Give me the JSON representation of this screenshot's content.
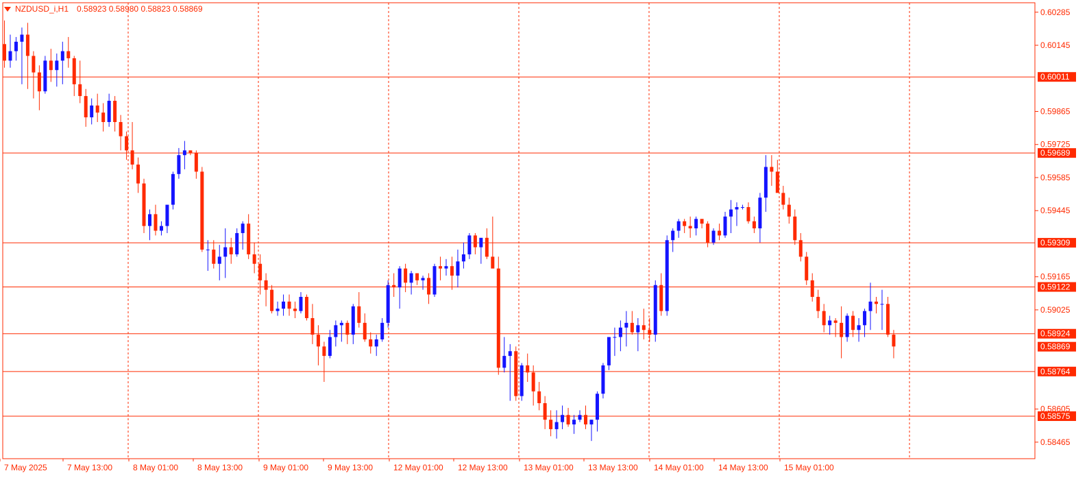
{
  "header": {
    "symbol": "NZDUSD_i,H1",
    "ohlc": "0.58923 0.58980 0.58823 0.58869"
  },
  "colors": {
    "bull": "#1414ff",
    "bear": "#ff2a00",
    "grid": "#ff2a00",
    "background": "#ffffff"
  },
  "chart_data": {
    "type": "candlestick",
    "timeframe": "H1",
    "ylim": [
      0.58395,
      0.60325
    ],
    "y_ticks": [
      "0.60285",
      "0.60145",
      "0.59865",
      "0.59725",
      "0.59585",
      "0.59445",
      "0.59165",
      "0.59025",
      "0.58605",
      "0.58465"
    ],
    "x_ticks": [
      "7 May 2025",
      "7 May 13:00",
      "8 May 01:00",
      "8 May 13:00",
      "9 May 01:00",
      "9 May 13:00",
      "12 May 01:00",
      "12 May 13:00",
      "13 May 01:00",
      "13 May 13:00",
      "14 May 01:00",
      "14 May 13:00",
      "15 May 01:00"
    ],
    "horizontal_levels": [
      "0.60011",
      "0.59689",
      "0.59309",
      "0.59122",
      "0.58924",
      "0.58764",
      "0.58575"
    ],
    "current_price": "0.58869",
    "candles": [
      [
        0.6015,
        0.6025,
        0.6005,
        0.6008
      ],
      [
        0.6008,
        0.6019,
        0.6005,
        0.6012
      ],
      [
        0.6012,
        0.6018,
        0.6008,
        0.6016
      ],
      [
        0.6016,
        0.6022,
        0.5998,
        0.6019
      ],
      [
        0.6019,
        0.6024,
        0.5996,
        0.601
      ],
      [
        0.601,
        0.6012,
        0.5992,
        0.6003
      ],
      [
        0.6003,
        0.6006,
        0.5987,
        0.5995
      ],
      [
        0.5995,
        0.601,
        0.5994,
        0.6008
      ],
      [
        0.6008,
        0.6013,
        0.5999,
        0.6004
      ],
      [
        0.6004,
        0.6011,
        0.5997,
        0.6008
      ],
      [
        0.6008,
        0.6016,
        0.5998,
        0.6012
      ],
      [
        0.6012,
        0.6018,
        0.6005,
        0.6009
      ],
      [
        0.6009,
        0.601,
        0.5993,
        0.5998
      ],
      [
        0.5998,
        0.6008,
        0.599,
        0.5993
      ],
      [
        0.5993,
        0.5996,
        0.598,
        0.5984
      ],
      [
        0.5984,
        0.5992,
        0.5981,
        0.5989
      ],
      [
        0.5989,
        0.5994,
        0.5982,
        0.5986
      ],
      [
        0.5986,
        0.599,
        0.5978,
        0.5982
      ],
      [
        0.5982,
        0.5994,
        0.598,
        0.5991
      ],
      [
        0.5991,
        0.5993,
        0.5978,
        0.5982
      ],
      [
        0.5982,
        0.5985,
        0.597,
        0.5976
      ],
      [
        0.5976,
        0.5978,
        0.5966,
        0.597
      ],
      [
        0.597,
        0.5982,
        0.5962,
        0.5964
      ],
      [
        0.5964,
        0.5967,
        0.5952,
        0.5956
      ],
      [
        0.5956,
        0.5958,
        0.5935,
        0.5938
      ],
      [
        0.5938,
        0.5945,
        0.5932,
        0.5943
      ],
      [
        0.5943,
        0.5947,
        0.5934,
        0.5936
      ],
      [
        0.5936,
        0.594,
        0.5934,
        0.5938
      ],
      [
        0.5938,
        0.5946,
        0.5935,
        0.5947
      ],
      [
        0.5947,
        0.5961,
        0.5945,
        0.596
      ],
      [
        0.596,
        0.5971,
        0.5958,
        0.5968
      ],
      [
        0.5968,
        0.5974,
        0.5962,
        0.597
      ],
      [
        0.597,
        0.597,
        0.5968,
        0.5969
      ],
      [
        0.5969,
        0.597,
        0.5958,
        0.5961
      ],
      [
        0.5961,
        0.5963,
        0.5927,
        0.5928
      ],
      [
        0.5928,
        0.5932,
        0.5919,
        0.5928
      ],
      [
        0.5928,
        0.5932,
        0.592,
        0.5922
      ],
      [
        0.5922,
        0.593,
        0.5915,
        0.5925
      ],
      [
        0.5925,
        0.5937,
        0.5916,
        0.5929
      ],
      [
        0.5929,
        0.5933,
        0.5922,
        0.5926
      ],
      [
        0.5926,
        0.5937,
        0.5925,
        0.5935
      ],
      [
        0.5935,
        0.594,
        0.5928,
        0.5939
      ],
      [
        0.5939,
        0.5943,
        0.5924,
        0.5926
      ],
      [
        0.5926,
        0.5931,
        0.5918,
        0.5922
      ],
      [
        0.5922,
        0.5926,
        0.5909,
        0.5915
      ],
      [
        0.5915,
        0.5918,
        0.5904,
        0.5911
      ],
      [
        0.5911,
        0.5913,
        0.5901,
        0.5902
      ],
      [
        0.5902,
        0.5906,
        0.59,
        0.5903
      ],
      [
        0.5903,
        0.5909,
        0.59,
        0.5906
      ],
      [
        0.5906,
        0.5909,
        0.59,
        0.5903
      ],
      [
        0.5903,
        0.5906,
        0.5899,
        0.5902
      ],
      [
        0.5902,
        0.591,
        0.5901,
        0.5908
      ],
      [
        0.5908,
        0.5909,
        0.5898,
        0.5899
      ],
      [
        0.5899,
        0.5905,
        0.5888,
        0.5892
      ],
      [
        0.5892,
        0.5896,
        0.5879,
        0.5887
      ],
      [
        0.5887,
        0.5889,
        0.5872,
        0.5883
      ],
      [
        0.5883,
        0.5894,
        0.5882,
        0.5891
      ],
      [
        0.5891,
        0.5898,
        0.5887,
        0.5896
      ],
      [
        0.5896,
        0.5898,
        0.5889,
        0.5897
      ],
      [
        0.5897,
        0.5898,
        0.5888,
        0.5892
      ],
      [
        0.5892,
        0.5905,
        0.5888,
        0.5904
      ],
      [
        0.5904,
        0.591,
        0.5895,
        0.5897
      ],
      [
        0.5897,
        0.5901,
        0.5889,
        0.589
      ],
      [
        0.589,
        0.5893,
        0.5884,
        0.5887
      ],
      [
        0.5887,
        0.5892,
        0.5883,
        0.589
      ],
      [
        0.589,
        0.5899,
        0.5889,
        0.5897
      ],
      [
        0.5897,
        0.5915,
        0.5895,
        0.5913
      ],
      [
        0.5913,
        0.5918,
        0.5908,
        0.5912
      ],
      [
        0.5912,
        0.5921,
        0.5903,
        0.592
      ],
      [
        0.592,
        0.5922,
        0.591,
        0.5914
      ],
      [
        0.5914,
        0.5919,
        0.5909,
        0.5918
      ],
      [
        0.5918,
        0.5918,
        0.5913,
        0.5915
      ],
      [
        0.5915,
        0.5917,
        0.5911,
        0.5916
      ],
      [
        0.5916,
        0.5918,
        0.5905,
        0.5909
      ],
      [
        0.5909,
        0.5922,
        0.5908,
        0.5921
      ],
      [
        0.5921,
        0.5925,
        0.5915,
        0.592
      ],
      [
        0.592,
        0.5924,
        0.5917,
        0.5921
      ],
      [
        0.5921,
        0.5925,
        0.5911,
        0.5917
      ],
      [
        0.5917,
        0.5928,
        0.5912,
        0.5923
      ],
      [
        0.5923,
        0.5931,
        0.592,
        0.5926
      ],
      [
        0.5926,
        0.5935,
        0.5924,
        0.5934
      ],
      [
        0.5934,
        0.5935,
        0.5926,
        0.5929
      ],
      [
        0.5929,
        0.5932,
        0.5922,
        0.5933
      ],
      [
        0.5933,
        0.5937,
        0.5924,
        0.5925
      ],
      [
        0.5925,
        0.5942,
        0.5924,
        0.592
      ],
      [
        0.592,
        0.5925,
        0.5875,
        0.5878
      ],
      [
        0.5878,
        0.5891,
        0.5876,
        0.5883
      ],
      [
        0.5883,
        0.5888,
        0.5864,
        0.5885
      ],
      [
        0.5885,
        0.5887,
        0.5864,
        0.5866
      ],
      [
        0.5866,
        0.588,
        0.5864,
        0.5879
      ],
      [
        0.5879,
        0.5884,
        0.5872,
        0.5876
      ],
      [
        0.5876,
        0.5879,
        0.5862,
        0.5868
      ],
      [
        0.5868,
        0.5872,
        0.586,
        0.5863
      ],
      [
        0.5863,
        0.5866,
        0.5852,
        0.5856
      ],
      [
        0.5856,
        0.586,
        0.5849,
        0.5852
      ],
      [
        0.5852,
        0.586,
        0.5848,
        0.5855
      ],
      [
        0.5855,
        0.5862,
        0.5852,
        0.5858
      ],
      [
        0.5858,
        0.5861,
        0.5853,
        0.5854
      ],
      [
        0.5854,
        0.5858,
        0.585,
        0.5856
      ],
      [
        0.5856,
        0.586,
        0.5855,
        0.5858
      ],
      [
        0.5858,
        0.5862,
        0.5852,
        0.5854
      ],
      [
        0.5854,
        0.5856,
        0.5847,
        0.5856
      ],
      [
        0.5856,
        0.5868,
        0.5851,
        0.5867
      ],
      [
        0.5867,
        0.588,
        0.5865,
        0.5879
      ],
      [
        0.5879,
        0.589,
        0.5877,
        0.5891
      ],
      [
        0.5891,
        0.5895,
        0.5883,
        0.5891
      ],
      [
        0.5891,
        0.5898,
        0.5885,
        0.5895
      ],
      [
        0.5895,
        0.5902,
        0.5887,
        0.5897
      ],
      [
        0.5897,
        0.5902,
        0.5892,
        0.5893
      ],
      [
        0.5893,
        0.5899,
        0.5885,
        0.5896
      ],
      [
        0.5896,
        0.5903,
        0.589,
        0.5894
      ],
      [
        0.5894,
        0.5899,
        0.5889,
        0.5892
      ],
      [
        0.5892,
        0.5915,
        0.5889,
        0.5913
      ],
      [
        0.5913,
        0.5918,
        0.59,
        0.5902
      ],
      [
        0.5902,
        0.5934,
        0.59,
        0.5932
      ],
      [
        0.5932,
        0.5937,
        0.5927,
        0.5936
      ],
      [
        0.5936,
        0.5941,
        0.5933,
        0.594
      ],
      [
        0.594,
        0.5941,
        0.5935,
        0.5938
      ],
      [
        0.5938,
        0.5942,
        0.5933,
        0.5937
      ],
      [
        0.5937,
        0.5942,
        0.5934,
        0.5941
      ],
      [
        0.5941,
        0.594,
        0.5937,
        0.5939
      ],
      [
        0.5939,
        0.594,
        0.5929,
        0.5931
      ],
      [
        0.5931,
        0.5937,
        0.593,
        0.5936
      ],
      [
        0.5936,
        0.5939,
        0.5932,
        0.5934
      ],
      [
        0.5934,
        0.5944,
        0.5933,
        0.5942
      ],
      [
        0.5942,
        0.5949,
        0.5935,
        0.5945
      ],
      [
        0.5945,
        0.5948,
        0.5938,
        0.5946
      ],
      [
        0.5946,
        0.5947,
        0.5945,
        0.5946
      ],
      [
        0.5946,
        0.5948,
        0.5939,
        0.594
      ],
      [
        0.594,
        0.5942,
        0.5935,
        0.5937
      ],
      [
        0.5937,
        0.5952,
        0.5931,
        0.595
      ],
      [
        0.595,
        0.5968,
        0.5944,
        0.5963
      ],
      [
        0.5963,
        0.5968,
        0.5955,
        0.5961
      ],
      [
        0.5961,
        0.5966,
        0.5953,
        0.5952
      ],
      [
        0.5952,
        0.5955,
        0.5945,
        0.5947
      ],
      [
        0.5947,
        0.595,
        0.5939,
        0.5942
      ],
      [
        0.5942,
        0.5945,
        0.593,
        0.5932
      ],
      [
        0.5932,
        0.5935,
        0.5923,
        0.5925
      ],
      [
        0.5925,
        0.5927,
        0.5913,
        0.5915
      ],
      [
        0.5915,
        0.5918,
        0.5906,
        0.5908
      ],
      [
        0.5908,
        0.5911,
        0.5899,
        0.5902
      ],
      [
        0.5902,
        0.5905,
        0.5893,
        0.5896
      ],
      [
        0.5896,
        0.59,
        0.5892,
        0.5898
      ],
      [
        0.5898,
        0.5899,
        0.5891,
        0.5897
      ],
      [
        0.5897,
        0.5904,
        0.5882,
        0.5891
      ],
      [
        0.5891,
        0.5901,
        0.5889,
        0.59
      ],
      [
        0.59,
        0.5902,
        0.5891,
        0.5894
      ],
      [
        0.5894,
        0.5899,
        0.5889,
        0.5896
      ],
      [
        0.5896,
        0.5903,
        0.5891,
        0.5902
      ],
      [
        0.5902,
        0.5914,
        0.5894,
        0.5906
      ],
      [
        0.5906,
        0.5908,
        0.5901,
        0.5905
      ],
      [
        0.5905,
        0.5911,
        0.5894,
        0.5905
      ],
      [
        0.5905,
        0.5908,
        0.5891,
        0.5892
      ],
      [
        0.5892,
        0.5894,
        0.5882,
        0.5887
      ]
    ]
  }
}
